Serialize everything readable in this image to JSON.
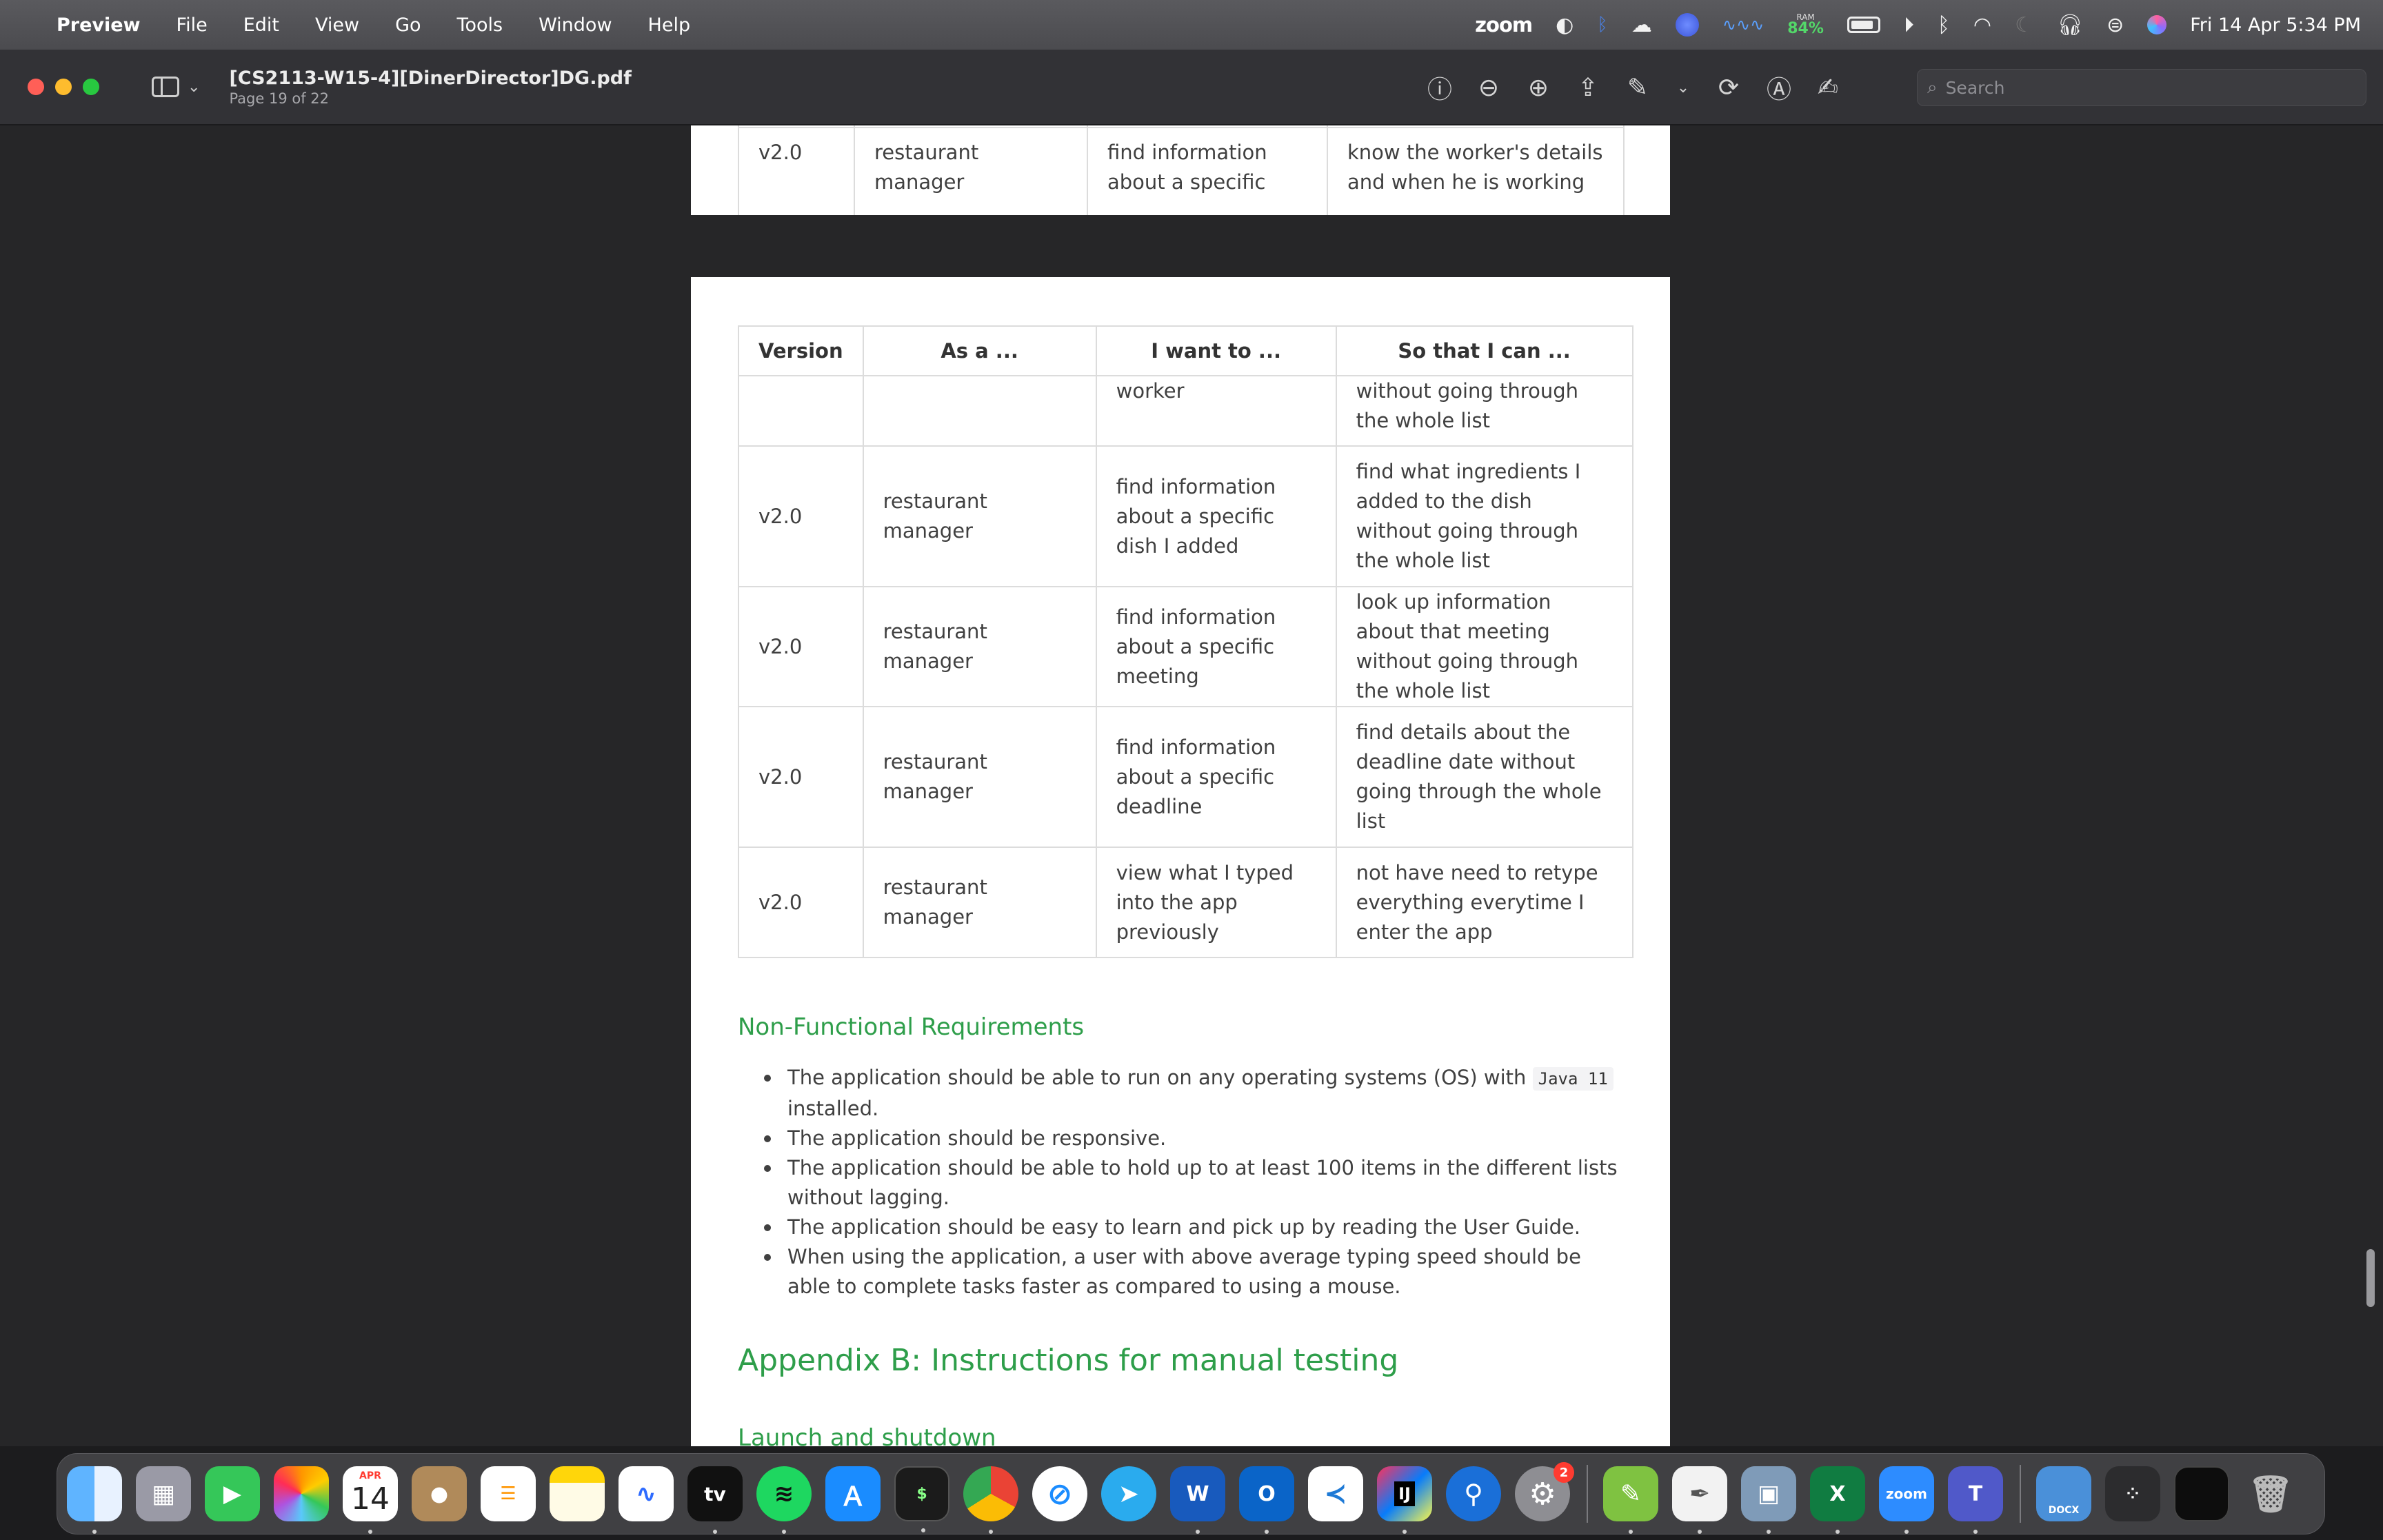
{
  "menubar": {
    "app_name": "Preview",
    "menus": [
      "File",
      "Edit",
      "View",
      "Go",
      "Tools",
      "Window",
      "Help"
    ],
    "zoom_label": "zoom",
    "ram_label": "RAM",
    "ram_value": "84%",
    "datetime": "Fri 14 Apr  5:34 PM"
  },
  "window": {
    "title": "[CS2113-W15-4][DinerDirector]DG.pdf",
    "subtitle": "Page 19 of 22",
    "search_placeholder": "Search"
  },
  "prev_page": {
    "row": {
      "version": "v2.0",
      "role": "restaurant manager",
      "want": "find information about a specific",
      "so_that": "know the worker's details and when he is working"
    }
  },
  "table": {
    "headers": [
      "Version",
      "As a ...",
      "I want to ...",
      "So that I can ..."
    ],
    "continuation": {
      "want": "worker",
      "so_that": "without going through the whole list"
    },
    "rows": [
      {
        "version": "v2.0",
        "role": "restaurant manager",
        "want": "find information about a specific dish I added",
        "so_that": "find what ingredients I added to the dish without going through the whole list"
      },
      {
        "version": "v2.0",
        "role": "restaurant manager",
        "want": "find information about a specific meeting",
        "so_that": "look up information about that meeting without going through the whole list"
      },
      {
        "version": "v2.0",
        "role": "restaurant manager",
        "want": "find information about a specific deadline",
        "so_that": "find details about the deadline date without going through the whole list"
      },
      {
        "version": "v2.0",
        "role": "restaurant manager",
        "want": "view what I typed into the app previously",
        "so_that": "not have need to retype everything everytime I enter the app"
      }
    ]
  },
  "nfr": {
    "heading": "Non-Functional Requirements",
    "item1_pre": "The application should be able to run on any operating systems (OS) with",
    "item1_code": "Java 11",
    "item1_post": "installed.",
    "item2": "The application should be responsive.",
    "item3": "The application should be able to hold up to at least 100 items in the different lists without lagging.",
    "item4": "The application should be easy to learn and pick up by reading the User Guide.",
    "item5": "When using the application, a user with above average typing speed should be able to complete tasks faster as compared to using a mouse."
  },
  "appendix_b": {
    "heading": "Appendix B: Instructions for manual testing",
    "subheading": "Launch and shutdown"
  },
  "dock": {
    "calendar_month": "APR",
    "calendar_day": "14",
    "appletv_label": "tv",
    "settings_badge": "2",
    "word_letter": "W",
    "outlook_letter": "O",
    "intellij_letter": "IJ",
    "excel_letter": "X",
    "zoom_letter": "zoom",
    "teams_letter": "T",
    "terminal_prompt": "$",
    "docx_label": "DOCX"
  }
}
